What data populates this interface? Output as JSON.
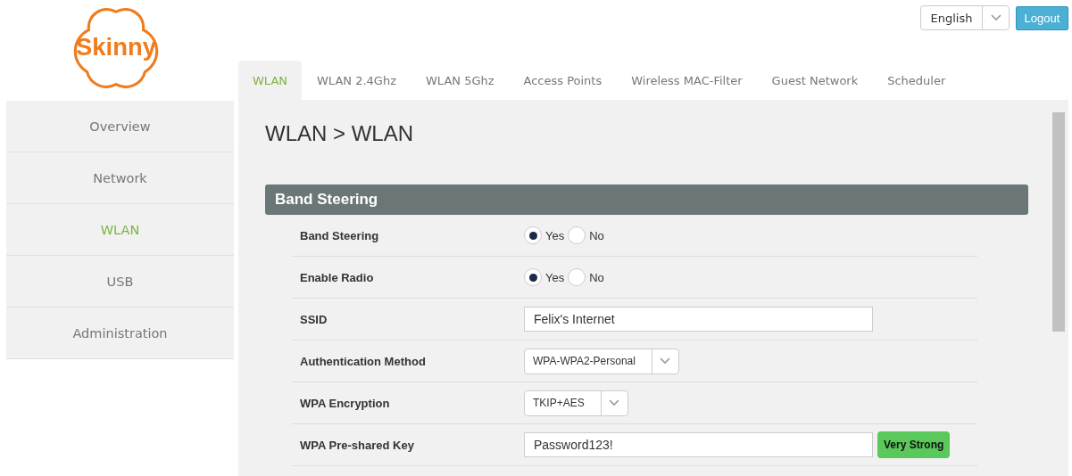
{
  "logo": "Skinny",
  "language": {
    "value": "English"
  },
  "logout": "Logout",
  "tabs": [
    {
      "label": "WLAN",
      "selected": true
    },
    {
      "label": "WLAN 2.4Ghz",
      "selected": false
    },
    {
      "label": "WLAN 5Ghz",
      "selected": false
    },
    {
      "label": "Access Points",
      "selected": false
    },
    {
      "label": "Wireless MAC-Filter",
      "selected": false
    },
    {
      "label": "Guest Network",
      "selected": false
    },
    {
      "label": "Scheduler",
      "selected": false
    }
  ],
  "sidebar": {
    "items": [
      {
        "label": "Overview",
        "selected": false
      },
      {
        "label": "Network",
        "selected": false
      },
      {
        "label": "WLAN",
        "selected": true
      },
      {
        "label": "USB",
        "selected": false
      },
      {
        "label": "Administration",
        "selected": false
      }
    ]
  },
  "page_title": "WLAN > WLAN",
  "section": {
    "title": "Band Steering",
    "rows": [
      {
        "kind": "radio",
        "label": "Band Steering",
        "options": [
          {
            "label": "Yes",
            "selected": true
          },
          {
            "label": "No",
            "selected": false
          }
        ]
      },
      {
        "kind": "radio",
        "label": "Enable Radio",
        "options": [
          {
            "label": "Yes",
            "selected": true
          },
          {
            "label": "No",
            "selected": false
          }
        ]
      },
      {
        "kind": "text",
        "label": "SSID",
        "value": "Felix's Internet"
      },
      {
        "kind": "select",
        "label": "Authentication Method",
        "value": "WPA-WPA2-Personal"
      },
      {
        "kind": "select",
        "label": "WPA Encryption",
        "value": "TKIP+AES"
      },
      {
        "kind": "key",
        "label": "WPA Pre-shared Key",
        "value": "Password123!",
        "strength": "Very Strong"
      }
    ]
  }
}
